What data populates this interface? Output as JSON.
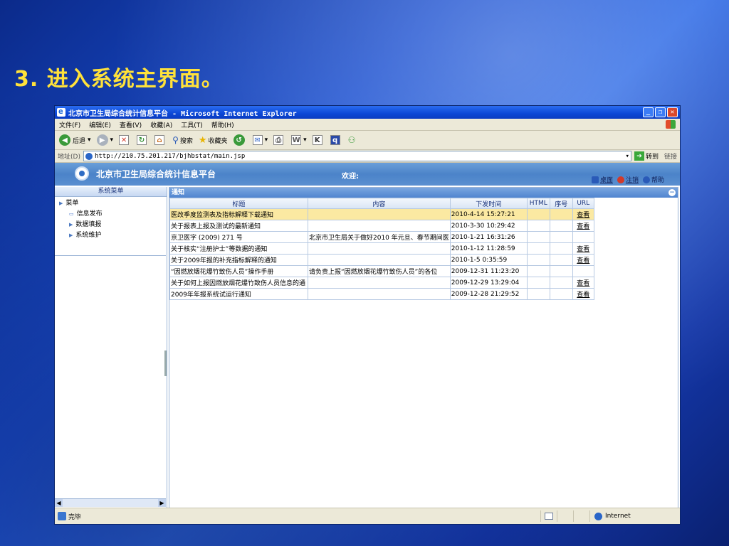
{
  "slide": {
    "title": "3. 进入系统主界面。"
  },
  "window": {
    "title": "北京市卫生局综合统计信息平台 - Microsoft Internet Explorer",
    "controls": {
      "minimize": "_",
      "maximize": "❐",
      "close": "✕"
    }
  },
  "menu": {
    "items": [
      "文件(F)",
      "编辑(E)",
      "查看(V)",
      "收藏(A)",
      "工具(T)",
      "帮助(H)"
    ]
  },
  "toolbar": {
    "back": "后退",
    "search": "搜索",
    "favorites": "收藏夹"
  },
  "address": {
    "label": "地址(D)",
    "url": "http://210.75.201.217/bjhbstat/main.jsp",
    "go": "转到",
    "links": "链接"
  },
  "app": {
    "title": "北京市卫生局综合统计信息平台",
    "welcome": "欢迎:",
    "desktop": "桌面",
    "logout": "注销",
    "help": "帮助"
  },
  "sidebar": {
    "header": "系统菜单",
    "root": "菜单",
    "items": [
      "信息发布",
      "数据填报",
      "系统维护"
    ]
  },
  "notice": {
    "panel_title": "通知",
    "columns": [
      "标题",
      "内容",
      "下发时间",
      "HTML",
      "序号",
      "URL"
    ],
    "rows": [
      {
        "title": "医改季度监测表及指标解释下载通知",
        "content": "",
        "time": "2010-4-14 15:27:21",
        "html": "",
        "seq": "",
        "url": "查看"
      },
      {
        "title": "关于报表上报及测试的最新通知",
        "content": "",
        "time": "2010-3-30 10:29:42",
        "html": "",
        "seq": "",
        "url": "查看"
      },
      {
        "title": "京卫医字 (2009) 271 号",
        "content": "北京市卫生局关于做好2010 年元旦、春节期间医",
        "time": "2010-1-21 16:31:26",
        "html": "",
        "seq": "",
        "url": ""
      },
      {
        "title": "关于核实“注册护士”等数据的通知",
        "content": "",
        "time": "2010-1-12 11:28:59",
        "html": "",
        "seq": "",
        "url": "查看"
      },
      {
        "title": "关于2009年报的补充指标解释的通知",
        "content": "",
        "time": "2010-1-5 0:35:59",
        "html": "",
        "seq": "",
        "url": "查看"
      },
      {
        "title": "“因燃放烟花爆竹致伤人员”操作手册",
        "content": "请负责上报“因燃放烟花爆竹致伤人员”的各位",
        "time": "2009-12-31 11:23:20",
        "html": "",
        "seq": "",
        "url": ""
      },
      {
        "title": "关于如何上报因燃放烟花爆竹致伤人员信息的通",
        "content": "",
        "time": "2009-12-29 13:29:04",
        "html": "",
        "seq": "",
        "url": "查看"
      },
      {
        "title": "2009年年报系统试运行通知",
        "content": "",
        "time": "2009-12-28 21:29:52",
        "html": "",
        "seq": "",
        "url": "查看"
      }
    ]
  },
  "status": {
    "text": "完毕",
    "zone": "Internet"
  }
}
